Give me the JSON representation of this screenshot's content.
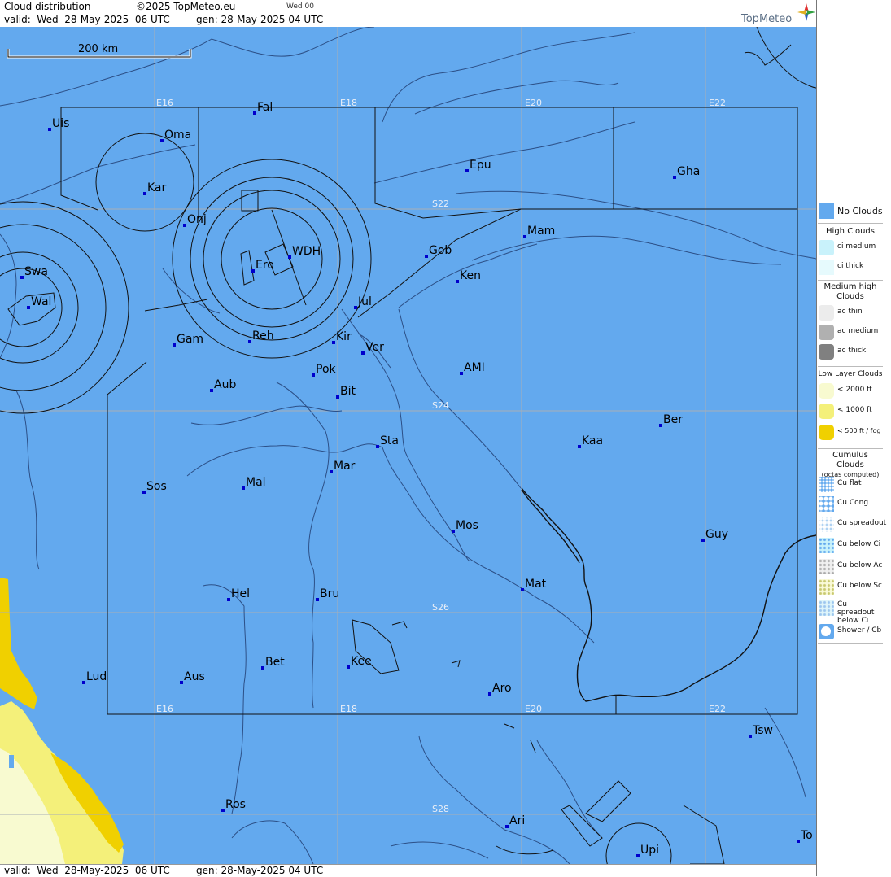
{
  "header": {
    "title": "Cloud distribution",
    "copyright": "©2025 TopMeteo.eu",
    "day_code": "Wed 00",
    "valid_line": "valid:  Wed  28-May-2025  06 UTC",
    "gen_line": "gen: 28-May-2025 04 UTC",
    "logo": "TopMeteo"
  },
  "footer": {
    "valid_line": "valid:  Wed  28-May-2025  06 UTC",
    "gen_line": "gen: 28-May-2025 04 UTC"
  },
  "map": {
    "scale_label": "200 km",
    "colors": {
      "sea": "#63a9ee",
      "fog": "#f0d000",
      "low": "#f4f07a",
      "pale": "#f8fad0"
    },
    "grid_labels": {
      "top_row": [
        "E16",
        "E18",
        "E20",
        "E22"
      ],
      "bottom_row": [
        "E16",
        "E18",
        "E20",
        "E22"
      ],
      "latitudes": [
        "S22",
        "S24",
        "S26",
        "S28"
      ]
    },
    "cities": [
      {
        "name": "Uis"
      },
      {
        "name": "Fal"
      },
      {
        "name": "Oma"
      },
      {
        "name": "Kar"
      },
      {
        "name": "Epu"
      },
      {
        "name": "Gha"
      },
      {
        "name": "Onj"
      },
      {
        "name": "Mam"
      },
      {
        "name": "Swa"
      },
      {
        "name": "WDH"
      },
      {
        "name": "Gob"
      },
      {
        "name": "Ero"
      },
      {
        "name": "Ken"
      },
      {
        "name": "Wal"
      },
      {
        "name": "Jul"
      },
      {
        "name": "Gam"
      },
      {
        "name": "Reh"
      },
      {
        "name": "Kir"
      },
      {
        "name": "Ver"
      },
      {
        "name": "Pok"
      },
      {
        "name": "AMI"
      },
      {
        "name": "Aub"
      },
      {
        "name": "Bit"
      },
      {
        "name": "Ber"
      },
      {
        "name": "Sta"
      },
      {
        "name": "Kaa"
      },
      {
        "name": "Mar"
      },
      {
        "name": "Sos"
      },
      {
        "name": "Mal"
      },
      {
        "name": "Mos"
      },
      {
        "name": "Guy"
      },
      {
        "name": "Mat"
      },
      {
        "name": "Hel"
      },
      {
        "name": "Bru"
      },
      {
        "name": "Bet"
      },
      {
        "name": "Kee"
      },
      {
        "name": "Lud"
      },
      {
        "name": "Aus"
      },
      {
        "name": "Aro"
      },
      {
        "name": "Tsw"
      },
      {
        "name": "Ros"
      },
      {
        "name": "Ari"
      },
      {
        "name": "To"
      },
      {
        "name": "Upi"
      }
    ]
  },
  "legend": {
    "no_clouds": "No Clouds",
    "high_title": "High Clouds",
    "high_items": [
      "ci medium",
      "ci thick"
    ],
    "medium_title_1": "Medium high",
    "medium_title_2": "Clouds",
    "medium_items": [
      "ac thin",
      "ac medium",
      "ac thick"
    ],
    "low_title": "Low Layer Clouds",
    "low_items": [
      "< 2000 ft",
      "< 1000 ft",
      "< 500 ft / fog"
    ],
    "cumulus_title_1": "Cumulus Clouds",
    "cumulus_title_2": "(octas computed)",
    "cumulus_items": [
      "Cu flat",
      "Cu Cong",
      "Cu spreadout",
      "Cu below Ci",
      "Cu below Ac",
      "Cu below Sc",
      "Cu spreadout below Ci",
      "Shower / Cb"
    ]
  }
}
